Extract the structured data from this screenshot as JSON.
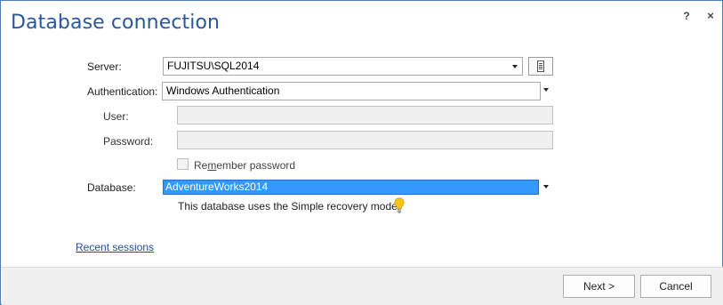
{
  "dialog": {
    "title": "Database connection",
    "help_label": "?",
    "close_label": "×"
  },
  "server": {
    "label": "Server:",
    "value": "FUJITSU\\SQL2014"
  },
  "authentication": {
    "label": "Authentication:",
    "value": "Windows Authentication"
  },
  "user": {
    "label": "User:",
    "value": ""
  },
  "password": {
    "label": "Password:",
    "value": ""
  },
  "remember": {
    "label": "Remember password",
    "checked": false
  },
  "database": {
    "label": "Database:",
    "value": "AdventureWorks2014",
    "info": "This database uses the Simple recovery model"
  },
  "links": {
    "recent_sessions": "Recent sessions"
  },
  "buttons": {
    "next": "Next >",
    "cancel": "Cancel"
  },
  "colors": {
    "title": "#2b579a",
    "selection": "#3399ff",
    "link": "#1f4e99",
    "bulb": "#f5c518"
  }
}
